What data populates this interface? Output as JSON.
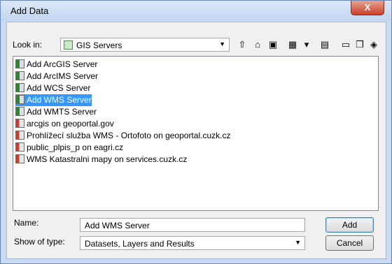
{
  "window": {
    "title": "Add Data",
    "close_glyph": "X"
  },
  "lookin": {
    "label": "Look in:",
    "value": "GIS Servers",
    "icon": "server-folder-icon"
  },
  "toolbar": [
    {
      "name": "up-one-level-icon",
      "glyph": "⇧"
    },
    {
      "name": "home-icon",
      "glyph": "⌂"
    },
    {
      "name": "connect-folder-icon",
      "glyph": "▣"
    },
    {
      "name": "view-list-icon",
      "glyph": "▦"
    },
    {
      "name": "view-dropdown-icon",
      "glyph": "▾"
    },
    {
      "name": "new-folder-icon",
      "glyph": "▤"
    },
    {
      "name": "catalog-icon",
      "glyph": "▭"
    },
    {
      "name": "toolbox-icon",
      "glyph": "❐"
    },
    {
      "name": "database-icon",
      "glyph": "◈"
    }
  ],
  "list": {
    "items": [
      {
        "label": "Add ArcGIS Server",
        "icon": "server"
      },
      {
        "label": "Add ArcIMS Server",
        "icon": "server"
      },
      {
        "label": "Add WCS Server",
        "icon": "server"
      },
      {
        "label": "Add WMS Server",
        "icon": "server",
        "selected": true
      },
      {
        "label": "Add WMTS Server",
        "icon": "server"
      },
      {
        "label": "arcgis on geoportal.gov",
        "icon": "conn"
      },
      {
        "label": "Prohlížecí služba WMS - Ortofoto on geoportal.cuzk.cz",
        "icon": "conn"
      },
      {
        "label": "public_plpis_p on eagri.cz",
        "icon": "conn"
      },
      {
        "label": "WMS Katastralni mapy on services.cuzk.cz",
        "icon": "conn"
      }
    ]
  },
  "name": {
    "label": "Name:",
    "value": "Add WMS Server"
  },
  "type": {
    "label": "Show of type:",
    "value": "Datasets, Layers and Results"
  },
  "buttons": {
    "add": "Add",
    "cancel": "Cancel"
  }
}
